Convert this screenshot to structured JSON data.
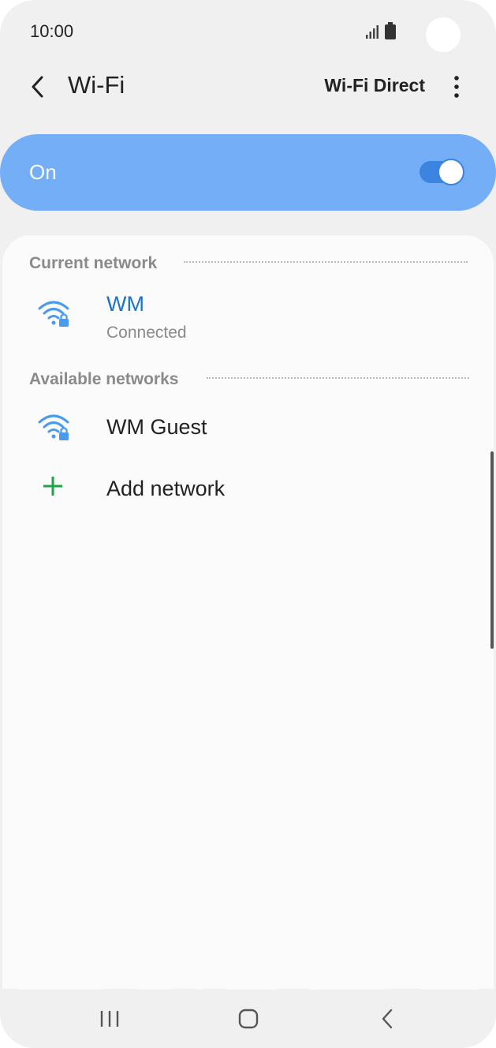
{
  "status_bar": {
    "time": "10:00",
    "icons": [
      "signal-icon",
      "battery-icon"
    ]
  },
  "header": {
    "title": "Wi-Fi",
    "wifi_direct_label": "Wi-Fi Direct",
    "icons": [
      "back-arrow-icon",
      "more-options-icon"
    ]
  },
  "master_toggle": {
    "label": "On",
    "state": true
  },
  "current_network": {
    "section_label": "Current network",
    "name": "WM",
    "status": "Connected",
    "icon": "wifi-lock-icon"
  },
  "available_networks": {
    "section_label": "Available networks",
    "items": [
      {
        "name": "WM Guest",
        "icon": "wifi-lock-icon"
      }
    ]
  },
  "add_network": {
    "label": "Add network",
    "icon": "plus-icon"
  },
  "nav_bar": {
    "icons": [
      "recent-apps-icon",
      "home-icon",
      "back-icon"
    ]
  },
  "colors": {
    "toggle_bar": "#73aef7",
    "switch_track": "#3b84e0",
    "wifi_icon": "#4a9af0",
    "connected_name": "#1b73c9",
    "plus_icon": "#1fa34a",
    "background": "#f0f0f0",
    "card": "#fbfbfb"
  }
}
